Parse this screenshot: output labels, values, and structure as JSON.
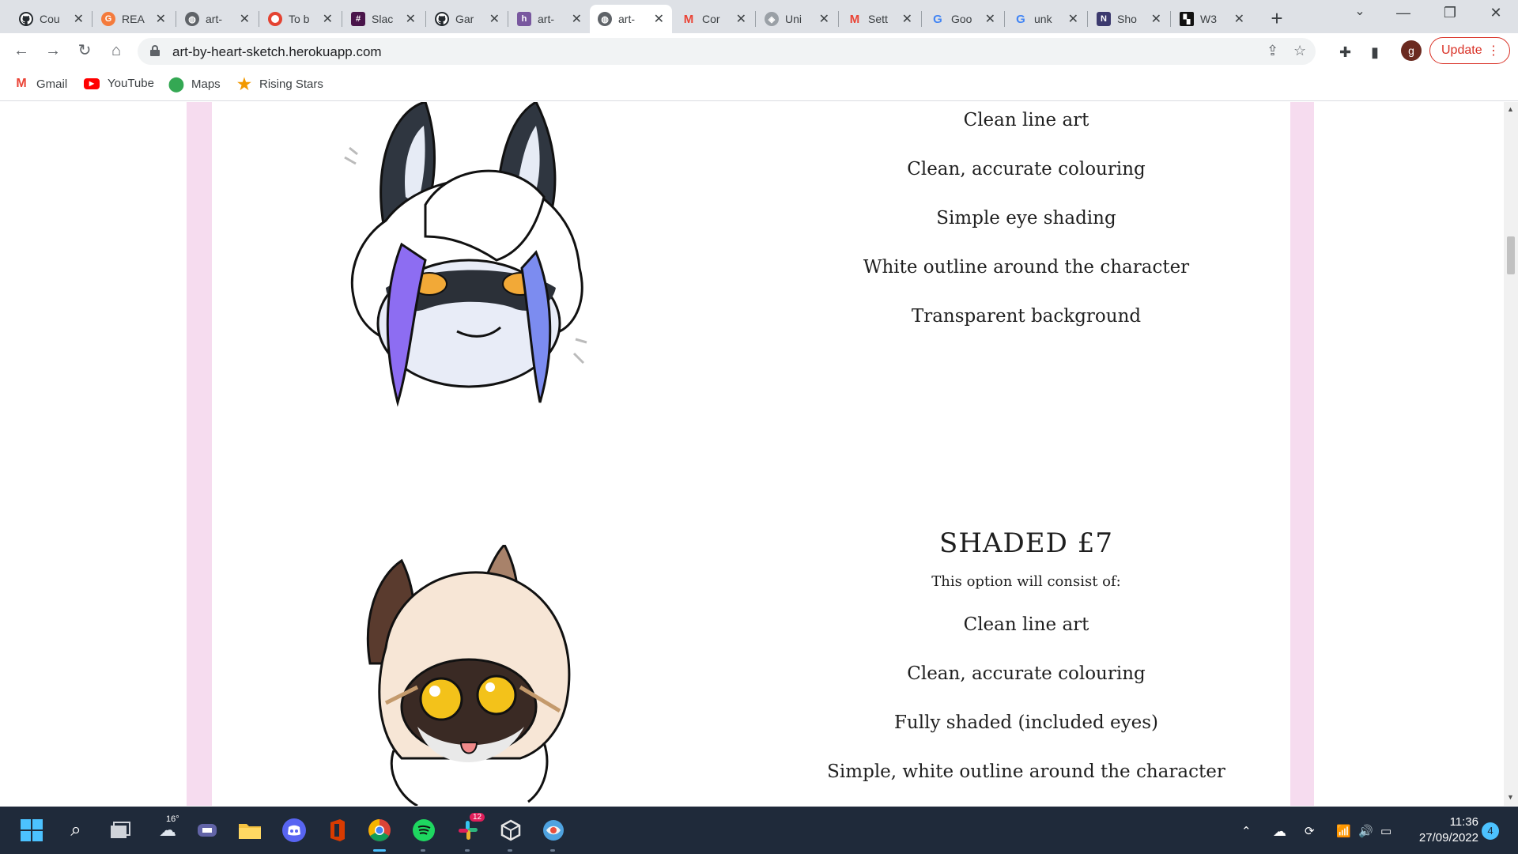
{
  "browser": {
    "tabs": [
      {
        "label": "Cou",
        "icon": "github-icon"
      },
      {
        "label": "REA",
        "icon": "grammarly-icon"
      },
      {
        "label": "art-",
        "icon": "globe-icon"
      },
      {
        "label": "To b",
        "icon": "todoist-icon"
      },
      {
        "label": "Slac",
        "icon": "slack-icon"
      },
      {
        "label": "Gar",
        "icon": "github-icon"
      },
      {
        "label": "art-",
        "icon": "heroku-icon"
      },
      {
        "label": "art-",
        "icon": "globe-icon",
        "active": true
      },
      {
        "label": "Cor",
        "icon": "gmail-icon"
      },
      {
        "label": "Uni",
        "icon": "unity-icon"
      },
      {
        "label": "Sett",
        "icon": "gmail-icon"
      },
      {
        "label": "Goo",
        "icon": "google-icon"
      },
      {
        "label": "unk",
        "icon": "google-icon"
      },
      {
        "label": "Sho",
        "icon": "shopify-icon"
      },
      {
        "label": "W3",
        "icon": "w3c-icon"
      }
    ],
    "url": "art-by-heart-sketch.herokuapp.com",
    "profile_initial": "g",
    "update_label": "Update",
    "bookmarks": [
      {
        "label": "Gmail",
        "icon": "gmail-icon"
      },
      {
        "label": "YouTube",
        "icon": "youtube-icon"
      },
      {
        "label": "Maps",
        "icon": "maps-icon"
      },
      {
        "label": "Rising Stars",
        "icon": "star-icon"
      }
    ]
  },
  "page": {
    "flat_features": [
      "Clean line art",
      "Clean, accurate colouring",
      "Simple eye shading",
      "White outline around the character",
      "Transparent background"
    ],
    "shaded": {
      "title": "SHADED £7",
      "subtitle": "This option will consist of:",
      "features": [
        "Clean line art",
        "Clean, accurate colouring",
        "Fully shaded (included eyes)",
        "Simple, white outline around the character"
      ]
    }
  },
  "taskbar": {
    "weather": "16°",
    "slack_badge": "12",
    "time": "11:36",
    "date": "27/09/2022",
    "notifications": "4"
  },
  "colors": {
    "accent_pink": "#f6dcef",
    "update_red": "#d93025",
    "taskbar_bg": "#1f2a3a"
  }
}
